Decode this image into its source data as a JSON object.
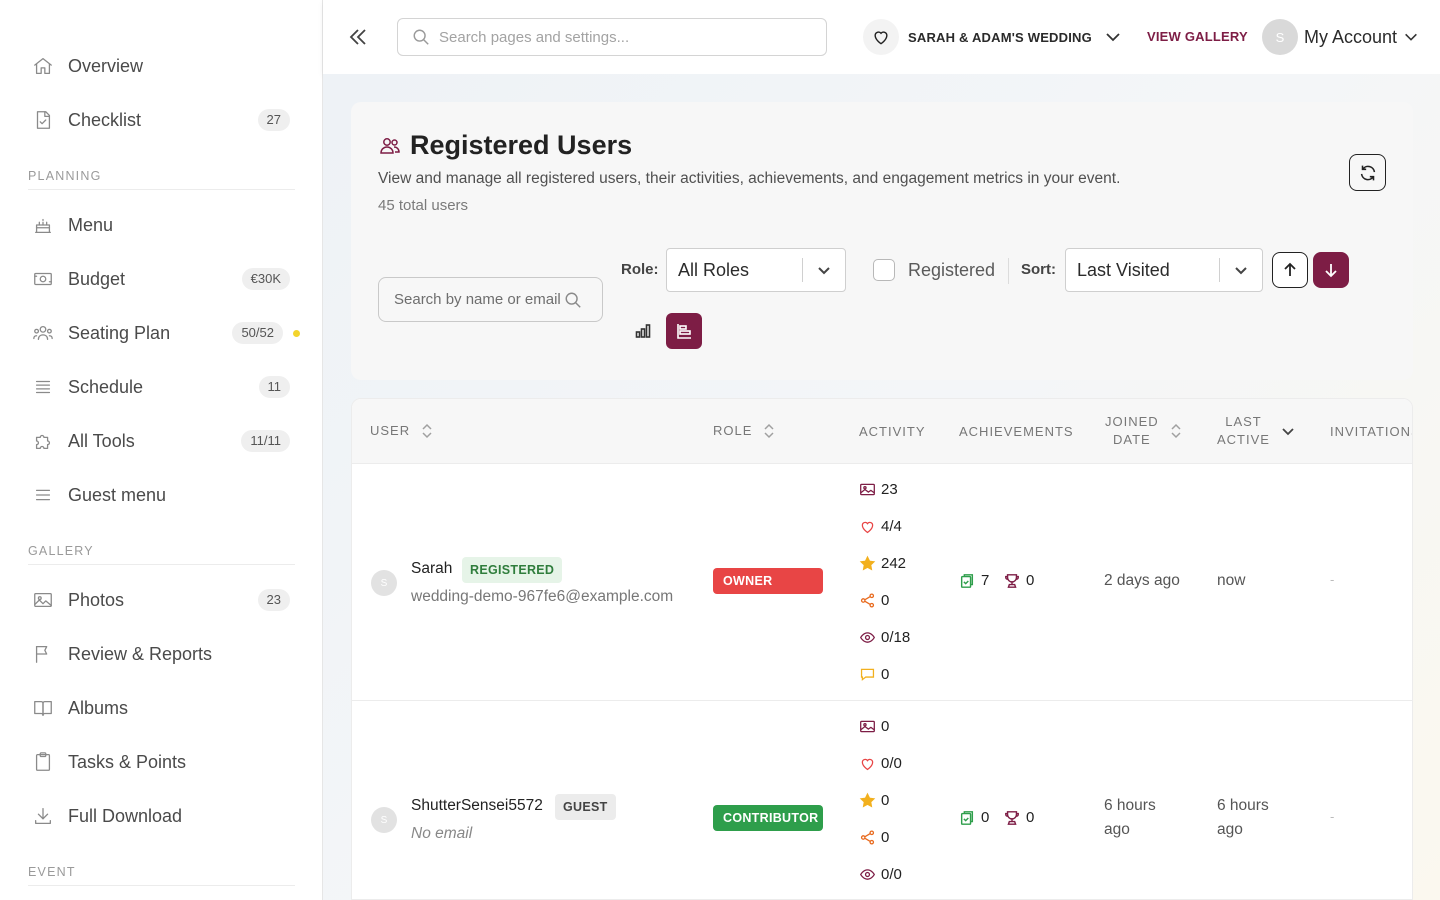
{
  "sidebar": {
    "items_top": [
      {
        "label": "Overview",
        "icon": "home-icon"
      },
      {
        "label": "Checklist",
        "icon": "checklist-icon",
        "badge": "27"
      }
    ],
    "sections": [
      {
        "title": "PLANNING",
        "items": [
          {
            "label": "Menu",
            "icon": "cake-icon"
          },
          {
            "label": "Budget",
            "icon": "money-icon",
            "badge": "€30K"
          },
          {
            "label": "Seating Plan",
            "icon": "users-icon",
            "badge": "50/52"
          },
          {
            "label": "Schedule",
            "icon": "list-icon",
            "badge": "11"
          },
          {
            "label": "All Tools",
            "icon": "puzzle-icon",
            "badge": "11/11"
          },
          {
            "label": "Guest menu",
            "icon": "menu-icon"
          }
        ]
      },
      {
        "title": "GALLERY",
        "items": [
          {
            "label": "Photos",
            "icon": "image-icon",
            "badge": "23"
          },
          {
            "label": "Review & Reports",
            "icon": "flag-icon"
          },
          {
            "label": "Albums",
            "icon": "book-icon"
          },
          {
            "label": "Tasks & Points",
            "icon": "clipboard-icon"
          },
          {
            "label": "Full Download",
            "icon": "download-icon"
          }
        ]
      },
      {
        "title": "EVENT",
        "items": []
      }
    ]
  },
  "topbar": {
    "search_placeholder": "Search pages and settings...",
    "event_name": "SARAH & ADAM'S WEDDING",
    "view_gallery": "VIEW GALLERY",
    "avatar_initial": "S",
    "account_label": "My Account"
  },
  "header": {
    "title": "Registered Users",
    "description": "View and manage all registered users, their activities, achievements, and engagement metrics in your event.",
    "count": "45 total users",
    "user_search_placeholder": "Search by name or email",
    "role_label": "Role:",
    "role_value": "All Roles",
    "registered_label": "Registered",
    "sort_label": "Sort:",
    "sort_value": "Last Visited"
  },
  "table": {
    "columns": {
      "user": "USER",
      "role": "ROLE",
      "activity": "ACTIVITY",
      "achievements": "ACHIEVEMENTS",
      "joined_line1": "JOINED",
      "joined_line2": "DATE",
      "last_line1": "LAST",
      "last_line2": "ACTIVE",
      "invitations": "INVITATIONS"
    },
    "rows": [
      {
        "avatar": "S",
        "name": "Sarah",
        "status": "REGISTERED",
        "email": "wedding-demo-967fe6@example.com",
        "role": "OWNER",
        "role_color": "#e84545",
        "activity": {
          "photos": "23",
          "likes": "4/4",
          "points": "242",
          "shares": "0",
          "views": "0/18",
          "comments": "0"
        },
        "ach_tasks": "7",
        "ach_trophies": "0",
        "joined": "2 days ago",
        "last_active": "now",
        "invitations": "-"
      },
      {
        "avatar": "S",
        "name": "ShutterSensei5572",
        "status": "GUEST",
        "email": "No email",
        "role": "CONTRIBUTOR",
        "role_color": "#2e9e4b",
        "activity": {
          "photos": "0",
          "likes": "0/0",
          "points": "0",
          "shares": "0",
          "views": "0/0"
        },
        "ach_tasks": "0",
        "ach_trophies": "0",
        "joined_line1": "6 hours",
        "joined_line2": "ago",
        "last_line1": "6 hours",
        "last_line2": "ago",
        "invitations": "-"
      }
    ]
  },
  "colors": {
    "brand": "#7d1d45",
    "owner": "#e84545",
    "contributor": "#2e9e4b",
    "registered_bg": "#e6f4e8",
    "online_dot": "#f3d42c"
  }
}
